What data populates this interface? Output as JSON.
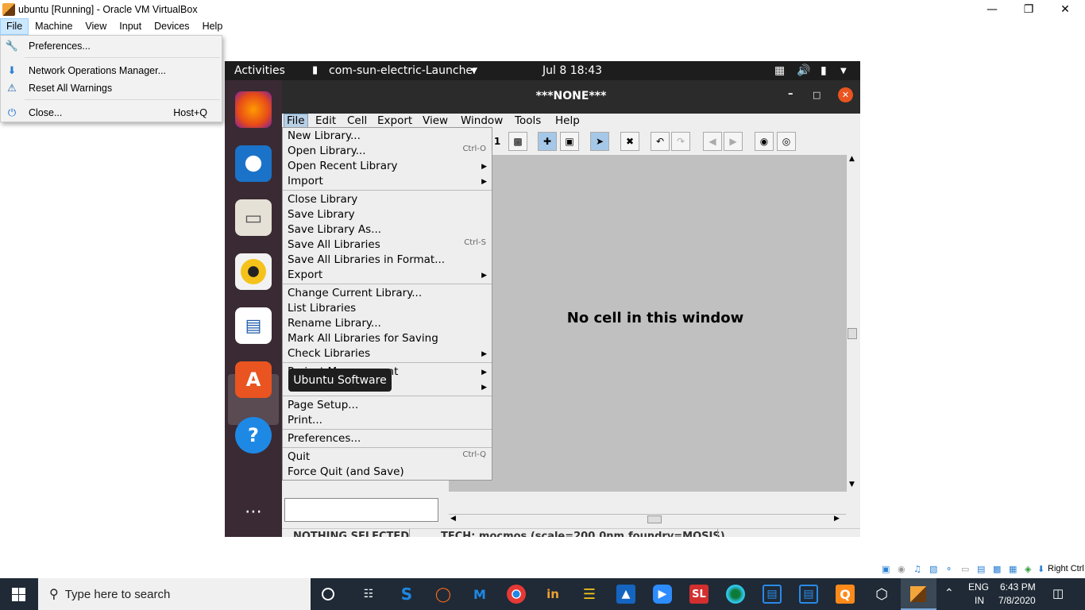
{
  "vbox": {
    "title": "ubuntu [Running] - Oracle VM VirtualBox",
    "menu": [
      "File",
      "Machine",
      "View",
      "Input",
      "Devices",
      "Help"
    ],
    "file_menu": {
      "preferences": "Preferences...",
      "network_ops": "Network Operations Manager...",
      "reset_warnings": "Reset All Warnings",
      "close": "Close...",
      "close_shortcut": "Host+Q"
    },
    "host_key": "Right Ctrl"
  },
  "gnome": {
    "activities": "Activities",
    "app_name": "com-sun-electric-Launcher",
    "clock": "Jul 8  18:43",
    "tooltip": "Ubuntu Software"
  },
  "electric": {
    "title": "***NONE***",
    "menu": [
      "File",
      "Edit",
      "Cell",
      "Export",
      "View",
      "Window",
      "Tools",
      "Help"
    ],
    "toolbar_num": "1",
    "canvas_message": "No cell in this window",
    "status_selection": "NOTHING SELECTED",
    "status_tech": "TECH: mocmos (scale=200.0nm,foundry=MOSIS)",
    "file_menu": {
      "new_library": "New Library...",
      "open_library": "Open Library...",
      "open_library_sc": "Ctrl-O",
      "open_recent": "Open Recent Library",
      "import": "Import",
      "close_library": "Close Library",
      "save_library": "Save Library",
      "save_library_as": "Save Library As...",
      "save_all": "Save All Libraries",
      "save_all_sc": "Ctrl-S",
      "save_all_format": "Save All Libraries in Format...",
      "export": "Export",
      "change_current": "Change Current Library...",
      "list_libraries": "List Libraries",
      "rename_library": "Rename Library...",
      "mark_all": "Mark All Libraries for Saving",
      "check_libraries": "Check Libraries",
      "project_mgmt": "Project Management",
      "page_setup": "Page Setup...",
      "print": "Print...",
      "preferences": "Preferences...",
      "quit": "Quit",
      "quit_sc": "Ctrl-Q",
      "force_quit": "Force Quit (and Save)"
    }
  },
  "taskbar": {
    "search_placeholder": "Type here to search",
    "lang": "ENG",
    "region": "IN",
    "time": "6:43 PM",
    "date": "7/8/2020"
  }
}
